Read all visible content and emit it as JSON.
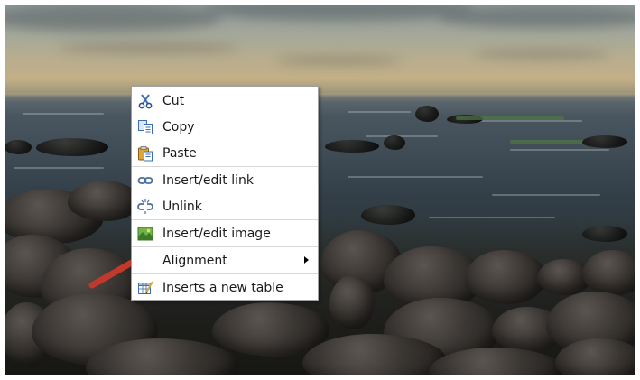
{
  "context_menu": {
    "items": [
      {
        "label": "Cut",
        "icon": "scissors-icon"
      },
      {
        "label": "Copy",
        "icon": "copy-icon"
      },
      {
        "label": "Paste",
        "icon": "paste-icon"
      },
      {
        "label": "Insert/edit link",
        "icon": "link-icon"
      },
      {
        "label": "Unlink",
        "icon": "unlink-icon"
      },
      {
        "label": "Insert/edit image",
        "icon": "image-icon"
      },
      {
        "label": "Alignment",
        "icon": "",
        "has_submenu": true
      },
      {
        "label": "Inserts a new table",
        "icon": "table-icon"
      }
    ]
  },
  "colors": {
    "menu_background": "#ffffff",
    "menu_border": "#a0a0a0",
    "separator": "#d8d8d8",
    "annotation_arrow": "#c0392b",
    "icon_blue": "#3a6fb5"
  }
}
